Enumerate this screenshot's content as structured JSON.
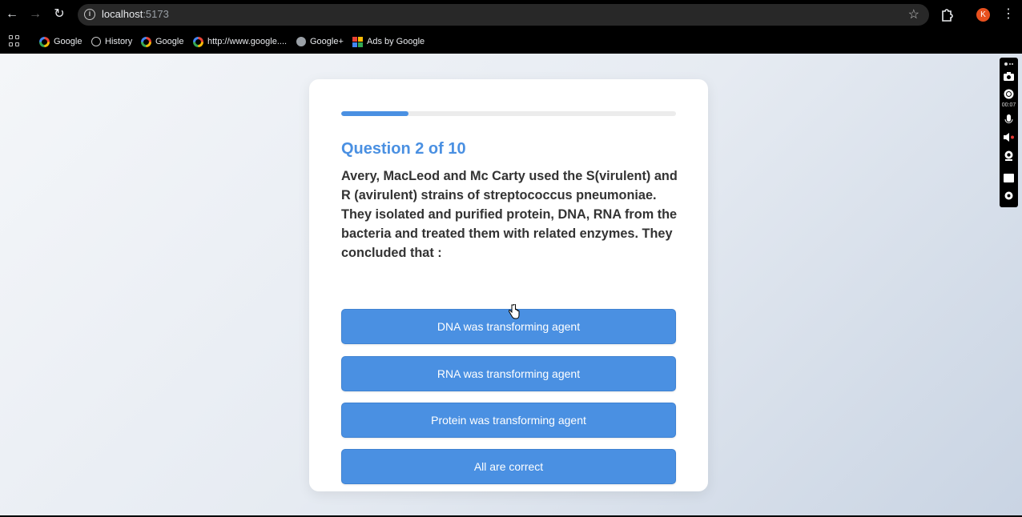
{
  "browser": {
    "url_host": "localhost",
    "url_port": ":5173",
    "profile_initial": "K",
    "bookmarks": [
      {
        "label": "Google",
        "icon": "google-icon"
      },
      {
        "label": "History",
        "icon": "history-icon"
      },
      {
        "label": "Google",
        "icon": "google-icon"
      },
      {
        "label": "http://www.google....",
        "icon": "google-icon"
      },
      {
        "label": "Google+",
        "icon": "globe-icon"
      },
      {
        "label": "Ads by Google",
        "icon": "ads-icon"
      }
    ]
  },
  "recorder": {
    "time": "00:07"
  },
  "quiz": {
    "progress": 0.2,
    "question_number": "Question 2 of 10",
    "question_text": "Avery, MacLeod and Mc Carty used the S(virulent) and R (avirulent) strains of streptococcus pneumoniae. They isolated and purified protein, DNA, RNA from the bacteria and treated them with related enzymes. They concluded that :",
    "options": [
      "DNA was transforming agent",
      "RNA was transforming agent",
      "Protein was transforming agent",
      "All are correct"
    ]
  },
  "colors": {
    "accent": "#4a90e2",
    "text": "#333333",
    "card": "#ffffff"
  }
}
